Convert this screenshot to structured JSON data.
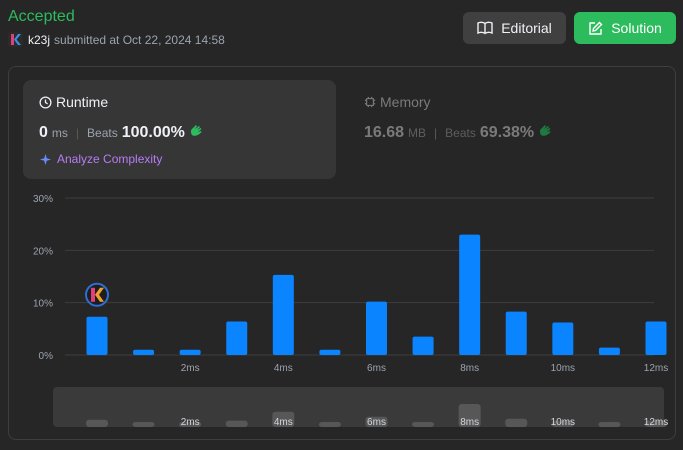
{
  "status": "Accepted",
  "user": {
    "name": "k23j",
    "submitted": "submitted at Oct 22, 2024 14:58"
  },
  "buttons": {
    "editorial": "Editorial",
    "solution": "Solution"
  },
  "runtime": {
    "title": "Runtime",
    "value": "0",
    "unit": "ms",
    "beats_label": "Beats",
    "beats": "100.00%",
    "analyze": "Analyze Complexity"
  },
  "memory": {
    "title": "Memory",
    "value": "16.68",
    "unit": "MB",
    "beats_label": "Beats",
    "beats": "69.38%"
  },
  "colors": {
    "accent": "#2cbb5d",
    "bar": "#0a84ff",
    "panel": "#363636"
  },
  "chart_data": {
    "type": "bar",
    "y_ticks": [
      "30%",
      "20%",
      "10%",
      "0%"
    ],
    "ylim": [
      0,
      30
    ],
    "grid": true,
    "x": [
      0,
      1,
      2,
      3,
      4,
      5,
      6,
      7,
      8,
      9,
      10,
      11,
      12
    ],
    "x_tick_labels": [
      {
        "x": 2,
        "label": "2ms"
      },
      {
        "x": 4,
        "label": "4ms"
      },
      {
        "x": 6,
        "label": "6ms"
      },
      {
        "x": 8,
        "label": "8ms"
      },
      {
        "x": 10,
        "label": "10ms"
      },
      {
        "x": 12,
        "label": "12ms"
      }
    ],
    "values": [
      7.3,
      1.0,
      1.0,
      6.4,
      15.3,
      1.0,
      10.2,
      3.5,
      23.0,
      8.3,
      6.2,
      1.4,
      6.4
    ],
    "highlight_x": 0
  }
}
